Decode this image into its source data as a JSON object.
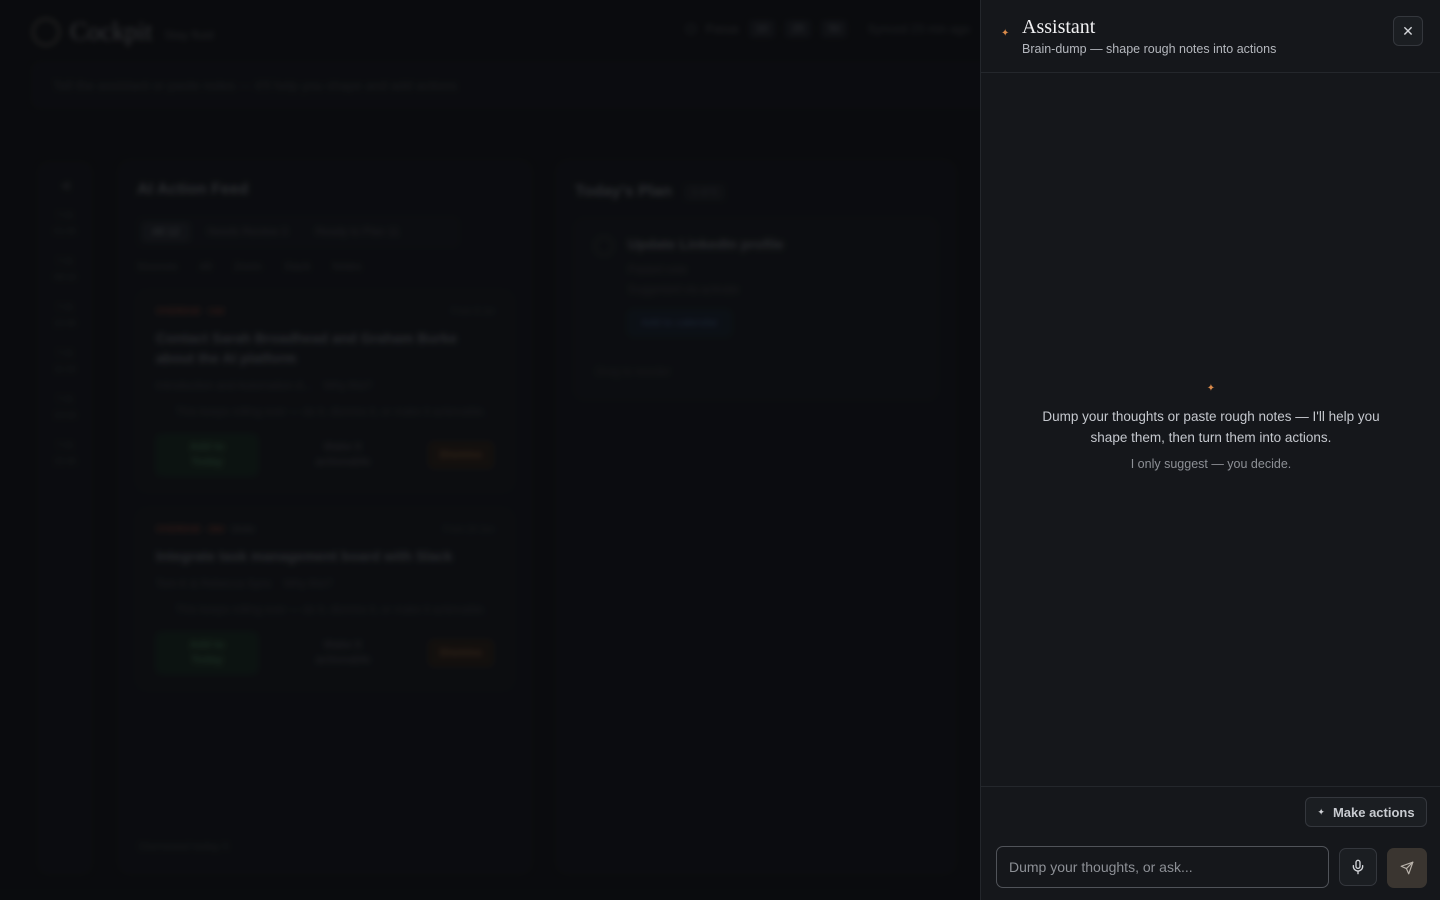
{
  "background": {
    "brand": "Cockpit",
    "tagline": "Stay fluid",
    "focus": {
      "label": "Focus",
      "options": [
        "10",
        "25",
        "50"
      ]
    },
    "synced": "Synced 23 min ago",
    "brain_dump_placeholder": "Tell the assistant or paste notes — it'll help you shape and add actions",
    "rail": [
      "7:31\n01:45",
      "7:31\n08:16",
      "7:31\n10:46",
      "7:31\n11:16",
      "7:31\n13:16",
      "7:31\n15:46"
    ],
    "feed": {
      "title": "AI Action Feed",
      "tabs": [
        {
          "label": "All",
          "count": "12"
        },
        {
          "label": "Needs Review",
          "count": "3"
        },
        {
          "label": "Ready to Plan",
          "count": "11"
        }
      ],
      "filters": [
        "Sources",
        "All",
        "Zoom",
        "Slack",
        "Notes"
      ],
      "cards": [
        {
          "meta": "OVERDUE · 14d",
          "date": "From 8 Jul",
          "title": "Contact Sarah Broadhead and Graham Burke about the AI platform",
          "source": "Introduction and Automation d...",
          "why": "Why this?",
          "note": "This keeps rolling over — do it, dismiss it, or make it actionable.",
          "add_label": "Add to Today",
          "actionable_label": "Make it actionable",
          "dismiss_label": "Dismiss"
        },
        {
          "meta": "OVERDUE · 28d",
          "date": "From 24 Jun",
          "undo": "Undo",
          "title": "Integrate task management board with Slack",
          "source": "Tom K & Rebecca Sync",
          "why": "Why this?",
          "note": "This keeps rolling over — do it, dismiss it, or make it actionable.",
          "add_label": "Add to Today",
          "actionable_label": "Make it actionable",
          "dismiss_label": "Dismiss"
        }
      ],
      "dismissed": "Dismissed today 5"
    },
    "plan": {
      "title": "Today's Plan",
      "count": "1 of 5",
      "card": {
        "title": "Update LinkedIn profile",
        "date": "From 24 Jul",
        "source": "Pasted note",
        "suggested": "Suggested via activate",
        "calendar_label": "Add to calendar",
        "drag_label": "Drag to reorder"
      }
    }
  },
  "assistant": {
    "title": "Assistant",
    "subtitle": "Brain-dump — shape rough notes into actions",
    "close_symbol": "✕",
    "empty": {
      "message": "Dump your thoughts or paste rough notes — I'll help you shape them, then turn them into actions.",
      "sub": "I only suggest — you decide."
    },
    "make_actions_label": "Make actions",
    "input_placeholder": "Dump your thoughts, or ask...",
    "accent_color": "#d98a4a"
  }
}
